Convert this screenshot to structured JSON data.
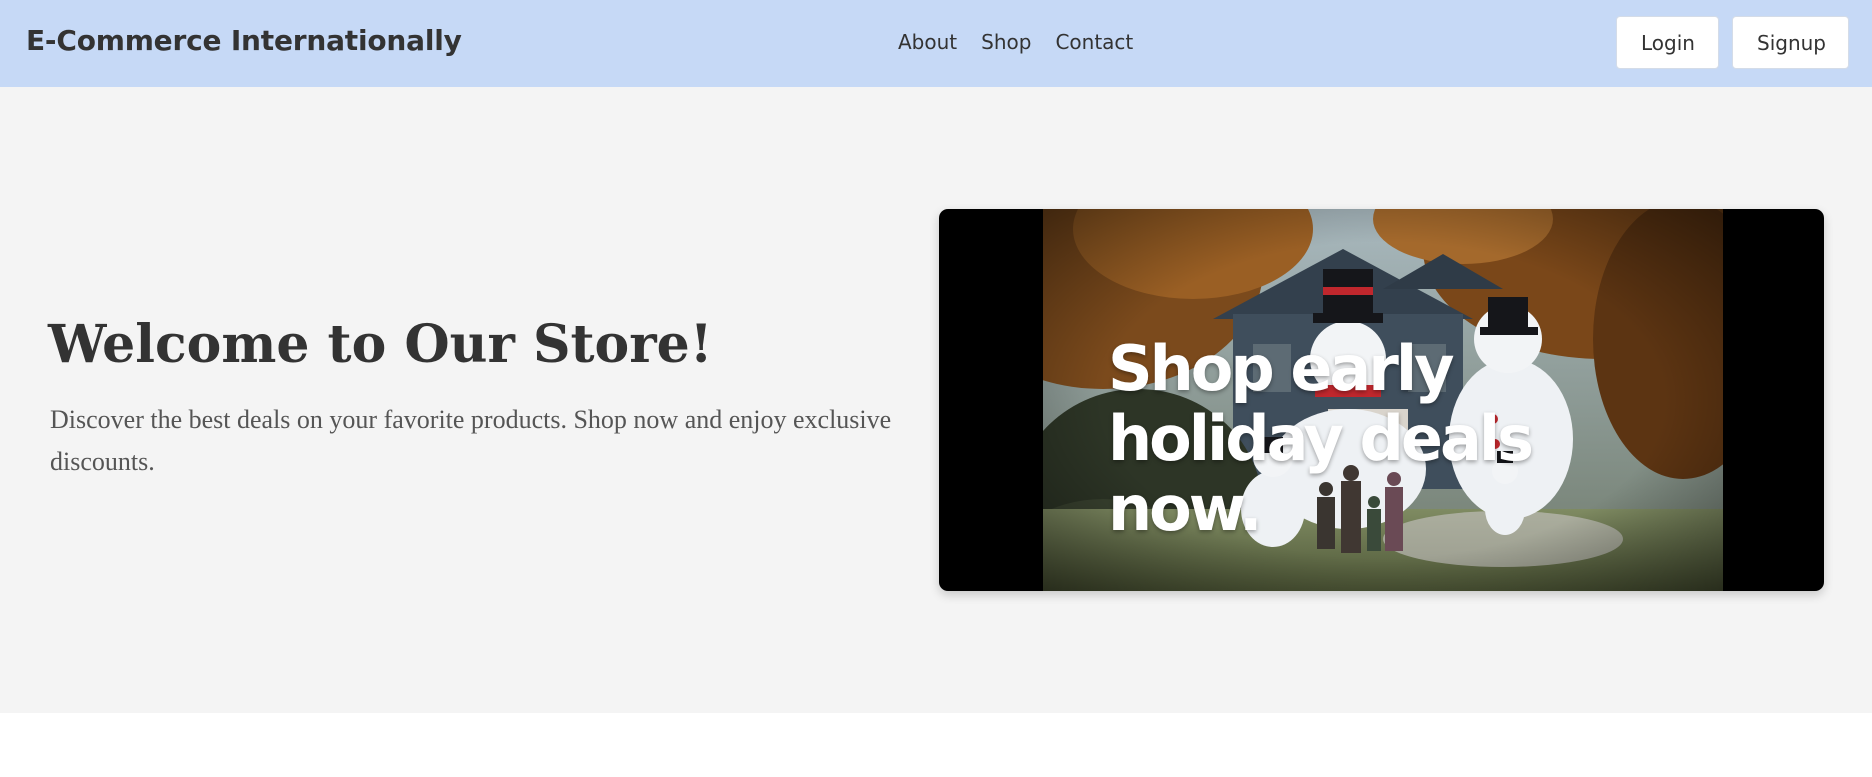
{
  "header": {
    "brand": "E-Commerce Internationally",
    "nav": [
      {
        "label": "About"
      },
      {
        "label": "Shop"
      },
      {
        "label": "Contact"
      }
    ],
    "login_label": "Login",
    "signup_label": "Signup"
  },
  "hero": {
    "title": "Welcome to Our Store!",
    "description": "Discover the best deals on your favorite products. Shop now and enjoy exclusive discounts.",
    "promo": {
      "headline": "Shop early holiday deals now."
    }
  },
  "colors": {
    "navbar_bg": "#c6d9f6",
    "hero_bg": "#f4f4f4",
    "text_dark": "#333333",
    "text_muted": "#555555"
  }
}
